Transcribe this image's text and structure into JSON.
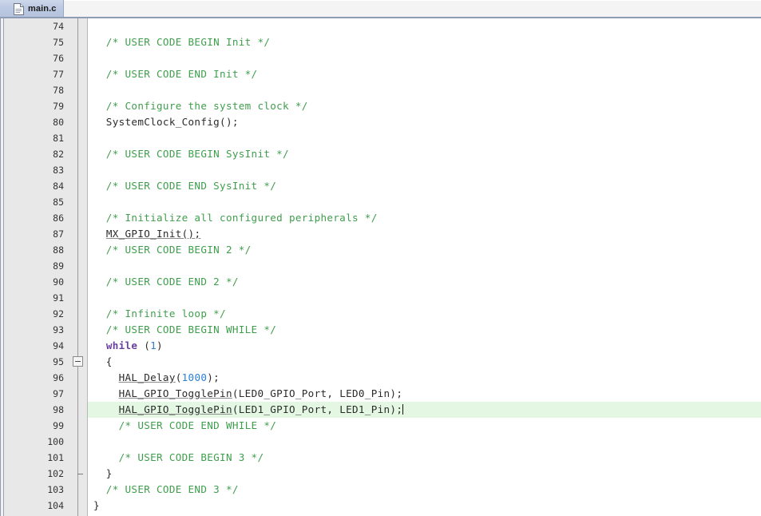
{
  "window": {
    "app": "code-editor",
    "accent_color": "#b4c2dd",
    "comment_color": "#3f9e4d",
    "keyword_color": "#6a3fa0",
    "number_color": "#2a7fd4",
    "current_line_color": "#e3f7e3"
  },
  "tabbar": {
    "tabs": [
      {
        "label": "main.c",
        "icon": "c-source-file-icon",
        "active": true
      }
    ]
  },
  "editor": {
    "first_line": 74,
    "last_line": 104,
    "current_line": 98,
    "caret_line": 98,
    "caret_column": 43,
    "fold_start_line": 95,
    "fold_end_line": 102,
    "lines": [
      {
        "n": 74,
        "parts": []
      },
      {
        "n": 75,
        "parts": [
          {
            "t": "  /* USER CODE BEGIN Init */",
            "c": "cmt"
          }
        ]
      },
      {
        "n": 76,
        "parts": []
      },
      {
        "n": 77,
        "parts": [
          {
            "t": "  /* USER CODE END Init */",
            "c": "cmt"
          }
        ]
      },
      {
        "n": 78,
        "parts": []
      },
      {
        "n": 79,
        "parts": [
          {
            "t": "  /* Configure the system clock */",
            "c": "cmt"
          }
        ]
      },
      {
        "n": 80,
        "parts": [
          {
            "t": "  SystemClock_Config();",
            "c": ""
          }
        ]
      },
      {
        "n": 81,
        "parts": []
      },
      {
        "n": 82,
        "parts": [
          {
            "t": "  /* USER CODE BEGIN SysInit */",
            "c": "cmt"
          }
        ]
      },
      {
        "n": 83,
        "parts": []
      },
      {
        "n": 84,
        "parts": [
          {
            "t": "  /* USER CODE END SysInit */",
            "c": "cmt"
          }
        ]
      },
      {
        "n": 85,
        "parts": []
      },
      {
        "n": 86,
        "parts": [
          {
            "t": "  /* Initialize all configured peripherals */",
            "c": "cmt"
          }
        ]
      },
      {
        "n": 87,
        "parts": [
          {
            "t": "  ",
            "c": ""
          },
          {
            "t": "MX_GPIO_Init();",
            "c": "und"
          }
        ]
      },
      {
        "n": 88,
        "parts": [
          {
            "t": "  /* USER CODE BEGIN 2 */",
            "c": "cmt"
          }
        ]
      },
      {
        "n": 89,
        "parts": []
      },
      {
        "n": 90,
        "parts": [
          {
            "t": "  /* USER CODE END 2 */",
            "c": "cmt"
          }
        ]
      },
      {
        "n": 91,
        "parts": []
      },
      {
        "n": 92,
        "parts": [
          {
            "t": "  /* Infinite loop */",
            "c": "cmt"
          }
        ]
      },
      {
        "n": 93,
        "parts": [
          {
            "t": "  /* USER CODE BEGIN WHILE */",
            "c": "cmt"
          }
        ]
      },
      {
        "n": 94,
        "parts": [
          {
            "t": "  ",
            "c": ""
          },
          {
            "t": "while",
            "c": "kw"
          },
          {
            "t": " (",
            "c": ""
          },
          {
            "t": "1",
            "c": "num"
          },
          {
            "t": ")",
            "c": ""
          }
        ]
      },
      {
        "n": 95,
        "parts": [
          {
            "t": "  {",
            "c": ""
          }
        ]
      },
      {
        "n": 96,
        "parts": [
          {
            "t": "    ",
            "c": ""
          },
          {
            "t": "HAL_Delay",
            "c": "und"
          },
          {
            "t": "(",
            "c": ""
          },
          {
            "t": "1000",
            "c": "num"
          },
          {
            "t": ");",
            "c": ""
          }
        ]
      },
      {
        "n": 97,
        "parts": [
          {
            "t": "    ",
            "c": ""
          },
          {
            "t": "HAL_GPIO_TogglePin",
            "c": "und"
          },
          {
            "t": "(LED0_GPIO_Port, LED0_Pin);",
            "c": ""
          }
        ]
      },
      {
        "n": 98,
        "parts": [
          {
            "t": "    ",
            "c": ""
          },
          {
            "t": "HAL_GPIO_TogglePin",
            "c": "und"
          },
          {
            "t": "(LED1_GPIO_Port, LED1_Pin);",
            "c": ""
          }
        ],
        "highlight": true,
        "caret": true
      },
      {
        "n": 99,
        "parts": [
          {
            "t": "    /* USER CODE END WHILE */",
            "c": "cmt"
          }
        ]
      },
      {
        "n": 100,
        "parts": []
      },
      {
        "n": 101,
        "parts": [
          {
            "t": "    /* USER CODE BEGIN 3 */",
            "c": "cmt"
          }
        ]
      },
      {
        "n": 102,
        "parts": [
          {
            "t": "  }",
            "c": ""
          }
        ]
      },
      {
        "n": 103,
        "parts": [
          {
            "t": "  /* USER CODE END 3 */",
            "c": "cmt"
          }
        ]
      },
      {
        "n": 104,
        "parts": [
          {
            "t": "}",
            "c": ""
          }
        ]
      }
    ]
  }
}
